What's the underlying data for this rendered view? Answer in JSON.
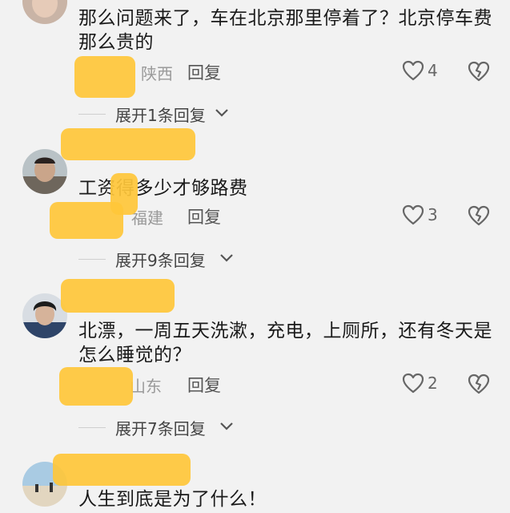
{
  "comments": [
    {
      "text": "那么问题来了，车在北京那里停着了？北京停车费那么贵的",
      "region": "陕西",
      "reply_label": "回复",
      "likes": "4",
      "expand_label": "展开1条回复"
    },
    {
      "text": "工资得多少才够路费",
      "region": "福建",
      "reply_label": "回复",
      "likes": "3",
      "expand_label": "展开9条回复"
    },
    {
      "text": "北漂，一周五天洗漱，充电，上厕所，还有冬天是怎么睡觉的？",
      "region": "山东",
      "reply_label": "回复",
      "likes": "2",
      "expand_label": "展开7条回复"
    },
    {
      "text": "人生到底是为了什么！"
    }
  ],
  "colors": {
    "background": "#f2f2f2",
    "text": "#1a1a1a",
    "meta": "#9a9a9a",
    "redaction": "#ffc73a"
  },
  "icons": {
    "like": "heart-outline-icon",
    "dislike": "broken-heart-icon",
    "expand": "chevron-down-icon"
  }
}
